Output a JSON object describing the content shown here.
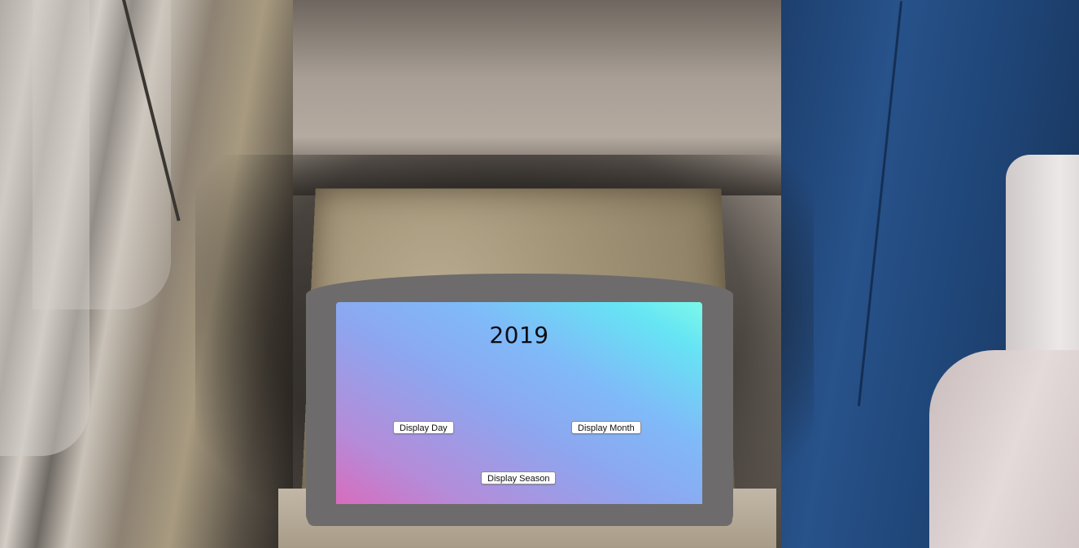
{
  "screen": {
    "year": "2019",
    "buttons": {
      "day": "Display Day",
      "month": "Display Month",
      "season": "Display Season"
    }
  },
  "colors": {
    "device_frame": "#6d6b6c",
    "screen_gradient_start": "#d86cbd",
    "screen_gradient_end": "#7cf9ea",
    "seat": "#27528a"
  }
}
